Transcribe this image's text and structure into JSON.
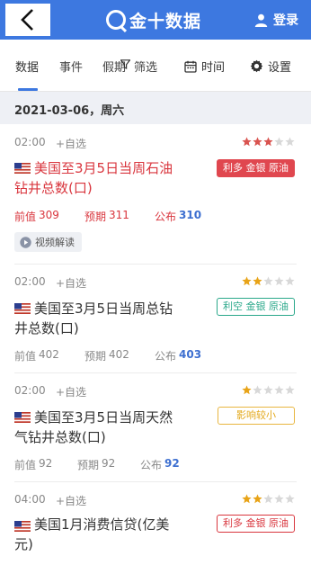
{
  "header": {
    "logo_text": "金十数据",
    "login_label": "登录"
  },
  "tabs": {
    "items": [
      "数据",
      "事件",
      "假期"
    ],
    "filter_label": "筛选",
    "time_label": "时间",
    "settings_label": "设置"
  },
  "date": "2021-03-06，周六",
  "events": [
    {
      "time": "02:00",
      "add_label": "+自选",
      "stars": 3,
      "title": "美国至3月5日当周石油钻井总数(口)",
      "tag": "利多 金银 原油",
      "prev_label": "前值",
      "prev": "309",
      "forecast_label": "预期",
      "forecast": "311",
      "actual_label": "公布",
      "actual": "310",
      "video_label": "视频解读"
    },
    {
      "time": "02:00",
      "add_label": "+自选",
      "stars": 2,
      "title": "美国至3月5日当周总钻井总数(口)",
      "tag": "利空 金银 原油",
      "prev_label": "前值",
      "prev": "402",
      "forecast_label": "预期",
      "forecast": "402",
      "actual_label": "公布",
      "actual": "403"
    },
    {
      "time": "02:00",
      "add_label": "+自选",
      "stars": 1,
      "title": "美国至3月5日当周天然气钻井总数(口)",
      "tag": "影响较小",
      "prev_label": "前值",
      "prev": "92",
      "forecast_label": "预期",
      "forecast": "92",
      "actual_label": "公布",
      "actual": "92"
    },
    {
      "time": "04:00",
      "add_label": "+自选",
      "stars": 2,
      "title": "美国1月消费信贷(亿美元)",
      "tag": "利多 金银 原油"
    }
  ],
  "colors": {
    "accent": "#3d78e0",
    "bullish": "#d9363e",
    "bearish": "#2aa88a",
    "neutral": "#e3a81b",
    "star_on": "#d9534f",
    "star_on_gold": "#e8a317",
    "star_off": "#d8d8d8"
  }
}
